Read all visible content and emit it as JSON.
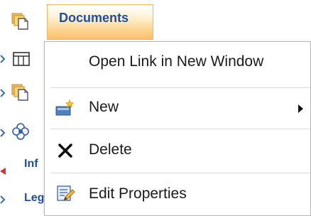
{
  "tree": {
    "selected_label": "Documents",
    "partial_items": [
      {
        "label": "Inf"
      },
      {
        "label": "Leg"
      }
    ]
  },
  "context_menu": {
    "items": [
      {
        "label": "Open Link in New Window",
        "icon": "none"
      },
      {
        "label": "New",
        "icon": "new-document-icon",
        "has_submenu": true
      },
      {
        "label": "Delete",
        "icon": "delete-x-icon"
      },
      {
        "label": "Edit Properties",
        "icon": "edit-properties-icon"
      }
    ]
  },
  "colors": {
    "link_blue": "#1f4e9c",
    "highlight_orange": "#f8c06a",
    "menu_border": "#b8b8b8"
  }
}
